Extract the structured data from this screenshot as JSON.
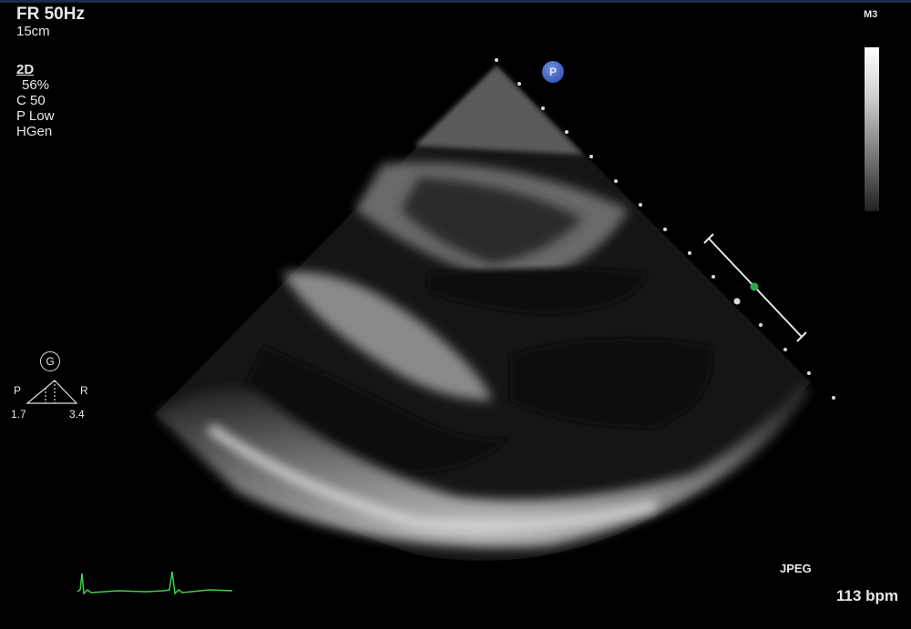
{
  "header": {
    "frame_rate": "FR 50Hz",
    "depth": "15cm"
  },
  "settings": {
    "mode": "2D",
    "gain": "56%",
    "compression": "C 50",
    "power": "P Low",
    "frequency": "HGen"
  },
  "map": {
    "name": "M3"
  },
  "probe_marker": {
    "letter": "P"
  },
  "orientation": {
    "top": "G",
    "left": "P",
    "right": "R",
    "left_value": "1.7",
    "right_value": "3.4"
  },
  "footer": {
    "format": "JPEG",
    "heart_rate": "113 bpm"
  },
  "colors": {
    "ecg_trace": "#3fcf4a",
    "marker": "#3a5fcf",
    "focus_dot": "#2fa84a"
  }
}
